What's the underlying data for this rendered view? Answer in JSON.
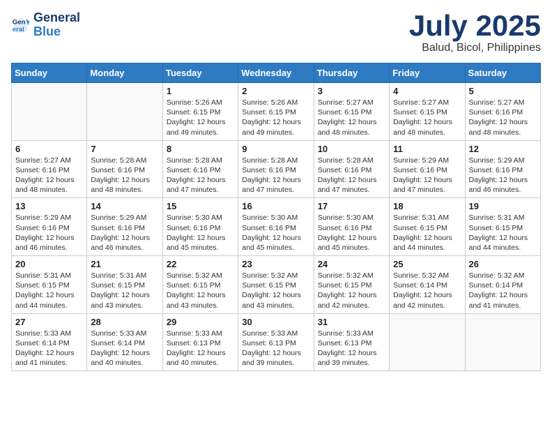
{
  "header": {
    "logo_line1": "General",
    "logo_line2": "Blue",
    "title": "July 2025",
    "subtitle": "Balud, Bicol, Philippines"
  },
  "weekdays": [
    "Sunday",
    "Monday",
    "Tuesday",
    "Wednesday",
    "Thursday",
    "Friday",
    "Saturday"
  ],
  "weeks": [
    [
      {
        "day": "",
        "info": ""
      },
      {
        "day": "",
        "info": ""
      },
      {
        "day": "1",
        "info": "Sunrise: 5:26 AM\nSunset: 6:15 PM\nDaylight: 12 hours and 49 minutes."
      },
      {
        "day": "2",
        "info": "Sunrise: 5:26 AM\nSunset: 6:15 PM\nDaylight: 12 hours and 49 minutes."
      },
      {
        "day": "3",
        "info": "Sunrise: 5:27 AM\nSunset: 6:15 PM\nDaylight: 12 hours and 48 minutes."
      },
      {
        "day": "4",
        "info": "Sunrise: 5:27 AM\nSunset: 6:15 PM\nDaylight: 12 hours and 48 minutes."
      },
      {
        "day": "5",
        "info": "Sunrise: 5:27 AM\nSunset: 6:16 PM\nDaylight: 12 hours and 48 minutes."
      }
    ],
    [
      {
        "day": "6",
        "info": "Sunrise: 5:27 AM\nSunset: 6:16 PM\nDaylight: 12 hours and 48 minutes."
      },
      {
        "day": "7",
        "info": "Sunrise: 5:28 AM\nSunset: 6:16 PM\nDaylight: 12 hours and 48 minutes."
      },
      {
        "day": "8",
        "info": "Sunrise: 5:28 AM\nSunset: 6:16 PM\nDaylight: 12 hours and 47 minutes."
      },
      {
        "day": "9",
        "info": "Sunrise: 5:28 AM\nSunset: 6:16 PM\nDaylight: 12 hours and 47 minutes."
      },
      {
        "day": "10",
        "info": "Sunrise: 5:28 AM\nSunset: 6:16 PM\nDaylight: 12 hours and 47 minutes."
      },
      {
        "day": "11",
        "info": "Sunrise: 5:29 AM\nSunset: 6:16 PM\nDaylight: 12 hours and 47 minutes."
      },
      {
        "day": "12",
        "info": "Sunrise: 5:29 AM\nSunset: 6:16 PM\nDaylight: 12 hours and 46 minutes."
      }
    ],
    [
      {
        "day": "13",
        "info": "Sunrise: 5:29 AM\nSunset: 6:16 PM\nDaylight: 12 hours and 46 minutes."
      },
      {
        "day": "14",
        "info": "Sunrise: 5:29 AM\nSunset: 6:16 PM\nDaylight: 12 hours and 46 minutes."
      },
      {
        "day": "15",
        "info": "Sunrise: 5:30 AM\nSunset: 6:16 PM\nDaylight: 12 hours and 45 minutes."
      },
      {
        "day": "16",
        "info": "Sunrise: 5:30 AM\nSunset: 6:16 PM\nDaylight: 12 hours and 45 minutes."
      },
      {
        "day": "17",
        "info": "Sunrise: 5:30 AM\nSunset: 6:16 PM\nDaylight: 12 hours and 45 minutes."
      },
      {
        "day": "18",
        "info": "Sunrise: 5:31 AM\nSunset: 6:15 PM\nDaylight: 12 hours and 44 minutes."
      },
      {
        "day": "19",
        "info": "Sunrise: 5:31 AM\nSunset: 6:15 PM\nDaylight: 12 hours and 44 minutes."
      }
    ],
    [
      {
        "day": "20",
        "info": "Sunrise: 5:31 AM\nSunset: 6:15 PM\nDaylight: 12 hours and 44 minutes."
      },
      {
        "day": "21",
        "info": "Sunrise: 5:31 AM\nSunset: 6:15 PM\nDaylight: 12 hours and 43 minutes."
      },
      {
        "day": "22",
        "info": "Sunrise: 5:32 AM\nSunset: 6:15 PM\nDaylight: 12 hours and 43 minutes."
      },
      {
        "day": "23",
        "info": "Sunrise: 5:32 AM\nSunset: 6:15 PM\nDaylight: 12 hours and 43 minutes."
      },
      {
        "day": "24",
        "info": "Sunrise: 5:32 AM\nSunset: 6:15 PM\nDaylight: 12 hours and 42 minutes."
      },
      {
        "day": "25",
        "info": "Sunrise: 5:32 AM\nSunset: 6:14 PM\nDaylight: 12 hours and 42 minutes."
      },
      {
        "day": "26",
        "info": "Sunrise: 5:32 AM\nSunset: 6:14 PM\nDaylight: 12 hours and 41 minutes."
      }
    ],
    [
      {
        "day": "27",
        "info": "Sunrise: 5:33 AM\nSunset: 6:14 PM\nDaylight: 12 hours and 41 minutes."
      },
      {
        "day": "28",
        "info": "Sunrise: 5:33 AM\nSunset: 6:14 PM\nDaylight: 12 hours and 40 minutes."
      },
      {
        "day": "29",
        "info": "Sunrise: 5:33 AM\nSunset: 6:13 PM\nDaylight: 12 hours and 40 minutes."
      },
      {
        "day": "30",
        "info": "Sunrise: 5:33 AM\nSunset: 6:13 PM\nDaylight: 12 hours and 39 minutes."
      },
      {
        "day": "31",
        "info": "Sunrise: 5:33 AM\nSunset: 6:13 PM\nDaylight: 12 hours and 39 minutes."
      },
      {
        "day": "",
        "info": ""
      },
      {
        "day": "",
        "info": ""
      }
    ]
  ]
}
